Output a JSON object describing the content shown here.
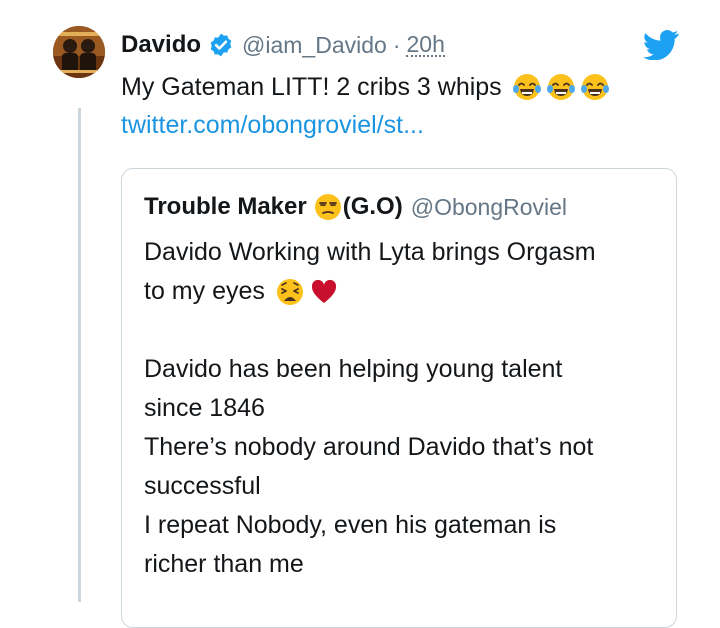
{
  "tweet": {
    "display_name": "Davido",
    "handle": "@iam_Davido",
    "separator": "·",
    "time": "20h",
    "text": "My Gateman LITT! 2 cribs 3 whips",
    "emojis": [
      "face-with-tears-of-joy",
      "face-with-tears-of-joy",
      "face-with-tears-of-joy"
    ],
    "link": "twitter.com/obongroviel/st..."
  },
  "quoted_tweet": {
    "display_name": "Trouble Maker",
    "name_suffix": "(G.O)",
    "name_emoji": "unamused-face",
    "handle": "@ObongRoviel",
    "lines": {
      "l1": "Davido Working with Lyta brings Orgasm",
      "l2": "to my eyes",
      "l3": "Davido has been helping young talent",
      "l4": "since 1846",
      "l5": "There’s nobody around Davido that’s not",
      "l6": "successful",
      "l7": "I repeat Nobody, even his gateman is",
      "l8": "richer than me"
    },
    "line2_emojis": [
      "weary-face",
      "red-heart"
    ]
  },
  "colors": {
    "link": "#1b95e0",
    "verified": "#1da1f2",
    "twitter_bird": "#1da1f2",
    "secondary_text": "#657786",
    "border": "#ccd6dd"
  },
  "icons": [
    "verified-badge-icon",
    "twitter-bird-icon"
  ]
}
